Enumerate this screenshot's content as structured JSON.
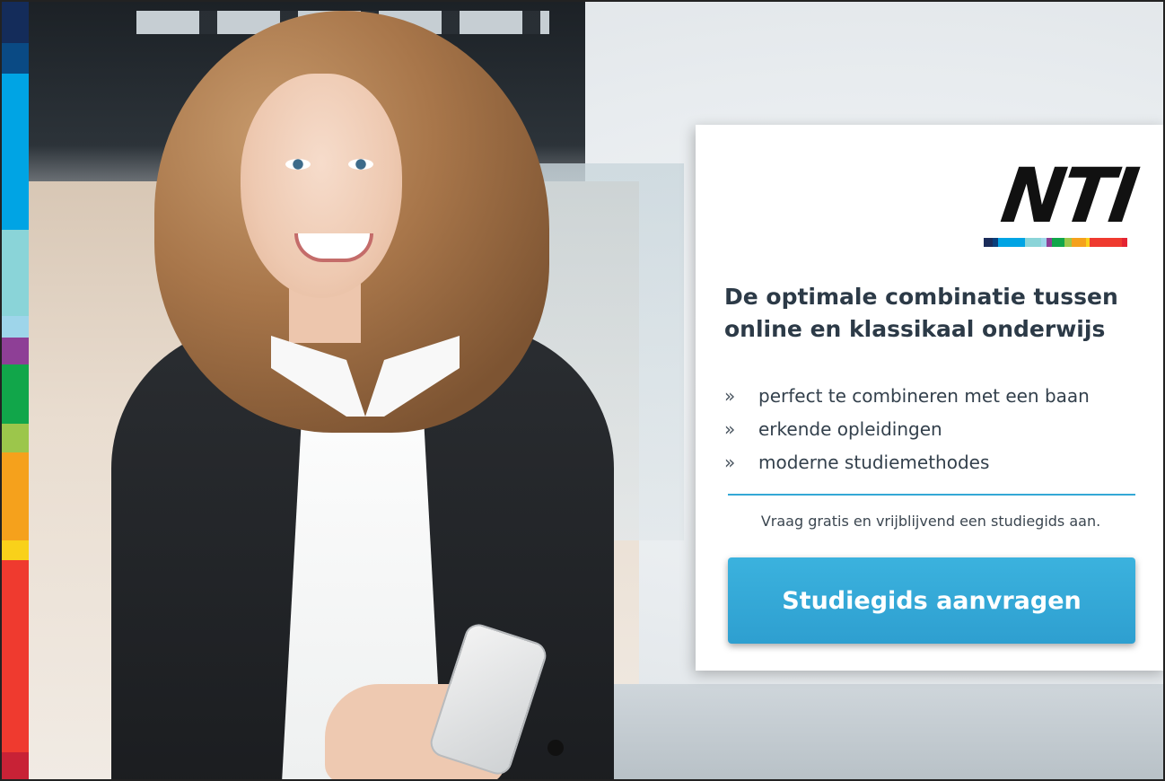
{
  "brand": {
    "logo_text": "NTI",
    "logo_bar_colors": [
      "#1b2c5a",
      "#0a3f7c",
      "#00a4e4",
      "#8ad4d8",
      "#9ed5ea",
      "#8e3f96",
      "#11a64a",
      "#9cc64b",
      "#f5a11c",
      "#f9d11a",
      "#ef3a2f",
      "#e32433"
    ]
  },
  "strip_colors": [
    "#142c5a",
    "#0a4a84",
    "#00a4e4",
    "#8ad4d8",
    "#9ed5ea",
    "#8e3f96",
    "#11a64a",
    "#9cc64b",
    "#f5a11c",
    "#f9d11a",
    "#ef3a2f",
    "#c82236"
  ],
  "panel": {
    "headline": "De optimale combinatie tussen online en klassikaal onderwijs",
    "bullet_glyph": "»",
    "benefits": [
      "perfect te combineren met een baan",
      "erkende opleidingen",
      "moderne studiemethodes"
    ],
    "note": "Vraag gratis en vrijblijvend een studiegids aan.",
    "cta_label": "Studiegids aanvragen"
  },
  "colors": {
    "accent": "#34a8d6",
    "headline": "#2c3a47"
  }
}
